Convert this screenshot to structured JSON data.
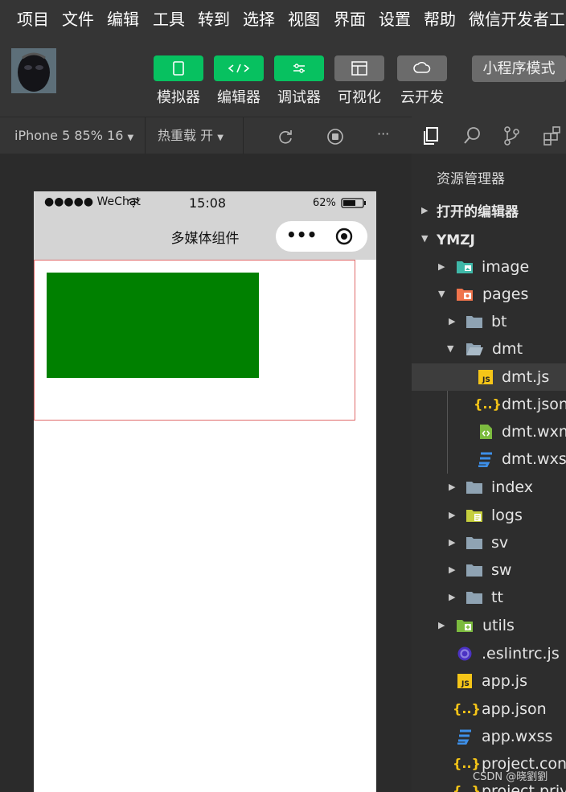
{
  "menubar": {
    "items": [
      "项目",
      "文件",
      "编辑",
      "工具",
      "转到",
      "选择",
      "视图",
      "界面",
      "设置",
      "帮助",
      "微信开发者工"
    ]
  },
  "toolbar": {
    "buttons": [
      {
        "label": "模拟器",
        "icon": "phone-icon"
      },
      {
        "label": "编辑器",
        "icon": "code-icon"
      },
      {
        "label": "调试器",
        "icon": "debug-icon"
      },
      {
        "label": "可视化",
        "icon": "layout-icon"
      },
      {
        "label": "云开发",
        "icon": "cloud-icon"
      }
    ],
    "mode_label": "小程序模式"
  },
  "simulator": {
    "device": "iPhone 5 85% 16",
    "hot_reload": "热重载 开",
    "more": "···"
  },
  "phone": {
    "carrier": "●●●●● WeChat",
    "time": "15:08",
    "battery": "62%",
    "nav_title": "多媒体组件",
    "capsule_more": "•••"
  },
  "explorer": {
    "title": "资源管理器",
    "tree": [
      {
        "label": "打开的编辑器",
        "type": "section",
        "expanded": false
      },
      {
        "label": "YMZJ",
        "type": "section",
        "expanded": true
      },
      {
        "label": "image",
        "type": "folder-image",
        "expanded": false
      },
      {
        "label": "pages",
        "type": "folder-pages",
        "expanded": true
      },
      {
        "label": "bt",
        "type": "folder",
        "expanded": false
      },
      {
        "label": "dmt",
        "type": "folder-open",
        "expanded": true
      },
      {
        "label": "dmt.js",
        "type": "js",
        "selected": true
      },
      {
        "label": "dmt.json",
        "type": "json"
      },
      {
        "label": "dmt.wxml",
        "type": "wxml"
      },
      {
        "label": "dmt.wxss",
        "type": "wxss"
      },
      {
        "label": "index",
        "type": "folder",
        "expanded": false
      },
      {
        "label": "logs",
        "type": "folder-logs",
        "expanded": false
      },
      {
        "label": "sv",
        "type": "folder",
        "expanded": false
      },
      {
        "label": "sw",
        "type": "folder",
        "expanded": false
      },
      {
        "label": "tt",
        "type": "folder",
        "expanded": false
      },
      {
        "label": "utils",
        "type": "folder-utils",
        "expanded": false
      },
      {
        "label": ".eslintrc.js",
        "type": "eslint"
      },
      {
        "label": "app.js",
        "type": "js"
      },
      {
        "label": "app.json",
        "type": "json"
      },
      {
        "label": "app.wxss",
        "type": "wxss"
      },
      {
        "label": "project.config.json",
        "type": "json"
      },
      {
        "label": "project.private.config.json",
        "type": "json"
      }
    ]
  },
  "watermark": "CSDN @晓劉劉",
  "colors": {
    "accent_green": "#07c160",
    "content_green": "#008000",
    "selection_border": "#e06a6a"
  }
}
